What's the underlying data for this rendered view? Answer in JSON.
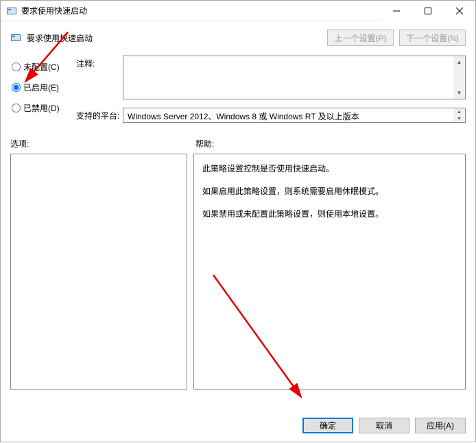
{
  "window": {
    "title": "要求使用快速启动"
  },
  "heading": "要求使用快速启动",
  "navButtons": {
    "prev": "上一个设置(P)",
    "next": "下一个设置(N)"
  },
  "radios": {
    "notConfigured": "未配置(C)",
    "enabled": "已启用(E)",
    "disabled": "已禁用(D)"
  },
  "labels": {
    "comment": "注释:",
    "platform": "支持的平台:",
    "options": "选项:",
    "help": "帮助:"
  },
  "platformText": "Windows Server 2012、Windows 8 或 Windows RT 及以上版本",
  "helpText": {
    "p1": "此策略设置控制是否使用快速启动。",
    "p2": "如果启用此策略设置，则系统需要启用休眠模式。",
    "p3": "如果禁用或未配置此策略设置，则使用本地设置。"
  },
  "buttons": {
    "ok": "确定",
    "cancel": "取消",
    "apply": "应用(A)"
  }
}
